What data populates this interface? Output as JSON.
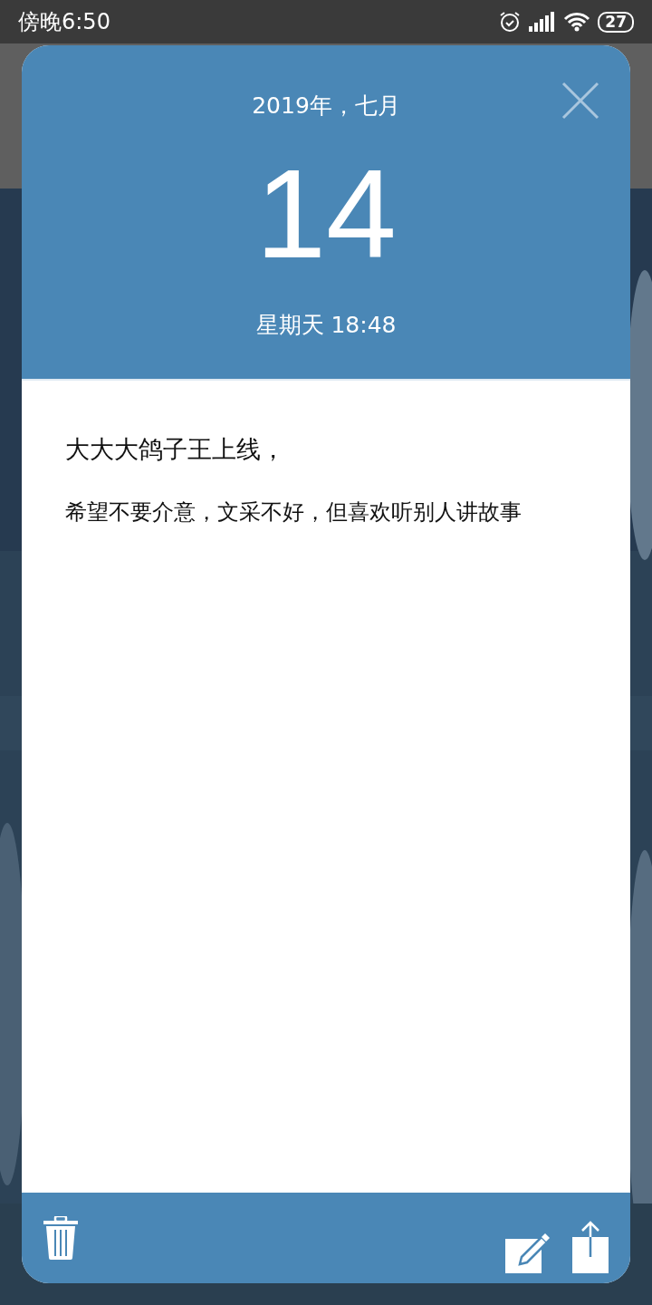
{
  "status_bar": {
    "time": "傍晚6:50",
    "battery": "27"
  },
  "dialog": {
    "month_year": "2019年，七月",
    "day": "14",
    "weekday_time": "星期天 18:48",
    "note": {
      "title": "大大大鸽子王上线，",
      "body": "希望不要介意，文采不好，但喜欢听别人讲故事"
    }
  }
}
